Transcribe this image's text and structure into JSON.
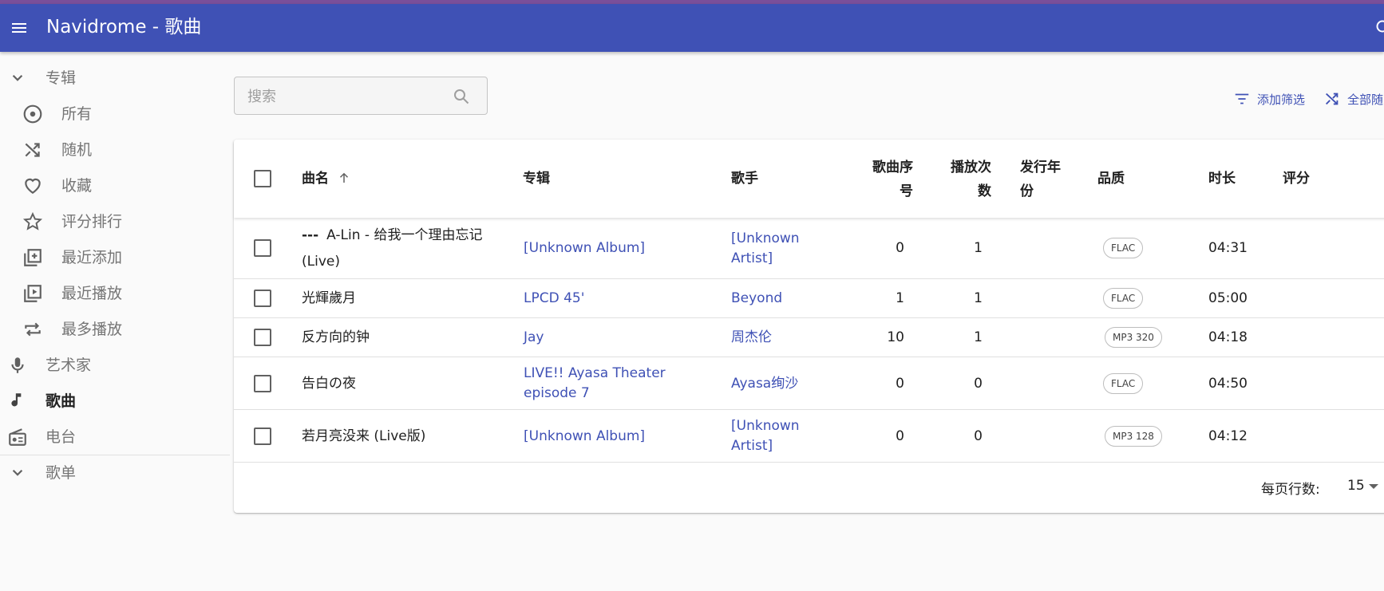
{
  "app": {
    "title": "Navidrome - 歌曲"
  },
  "sidebar": {
    "albums_header": "专辑",
    "items": [
      {
        "label": "所有",
        "icon": "album-disc-icon"
      },
      {
        "label": "随机",
        "icon": "shuffle-icon"
      },
      {
        "label": "收藏",
        "icon": "heart-icon"
      },
      {
        "label": "评分排行",
        "icon": "star-icon"
      },
      {
        "label": "最近添加",
        "icon": "library-add-icon"
      },
      {
        "label": "最近播放",
        "icon": "video-library-icon"
      },
      {
        "label": "最多播放",
        "icon": "repeat-icon"
      }
    ],
    "artists": "艺术家",
    "songs": "歌曲",
    "radio": "电台",
    "playlists_header": "歌单"
  },
  "search": {
    "placeholder": "搜索"
  },
  "toolbar": {
    "add_filter": "添加筛选",
    "shuffle_all": "全部随"
  },
  "table": {
    "columns": {
      "title": "曲名",
      "album": "专辑",
      "artist": "歌手",
      "track": "歌曲序号",
      "plays": "播放次数",
      "year": "发行年份",
      "quality": "品质",
      "duration": "时长",
      "rating": "评分"
    },
    "rows": [
      {
        "prefix": "---",
        "title": "A-Lin - 给我一个理由忘记 (Live)",
        "album": "[Unknown Album]",
        "artist": "[Unknown Artist]",
        "track": "0",
        "plays": "1",
        "quality": "FLAC",
        "duration": "04:31"
      },
      {
        "prefix": "",
        "title": "光輝歲月",
        "album": "LPCD 45'",
        "artist": "Beyond",
        "track": "1",
        "plays": "1",
        "quality": "FLAC",
        "duration": "05:00"
      },
      {
        "prefix": "",
        "title": "反方向的钟",
        "album": "Jay",
        "artist": "周杰伦",
        "track": "10",
        "plays": "1",
        "quality": "MP3 320",
        "duration": "04:18"
      },
      {
        "prefix": "",
        "title": "告白の夜",
        "album": "LIVE!! Ayasa Theater episode 7",
        "artist": "Ayasa绚沙",
        "track": "0",
        "plays": "0",
        "quality": "FLAC",
        "duration": "04:50"
      },
      {
        "prefix": "",
        "title": "若月亮没来 (Live版)",
        "album": "[Unknown Album]",
        "artist": "[Unknown Artist]",
        "track": "0",
        "plays": "0",
        "quality": "MP3 128",
        "duration": "04:12"
      }
    ]
  },
  "pagination": {
    "rows_per_page_label": "每页行数:",
    "rows_per_page": "15"
  },
  "colors": {
    "primary": "#3f51b5",
    "topstrip": "#7a4f9a"
  }
}
